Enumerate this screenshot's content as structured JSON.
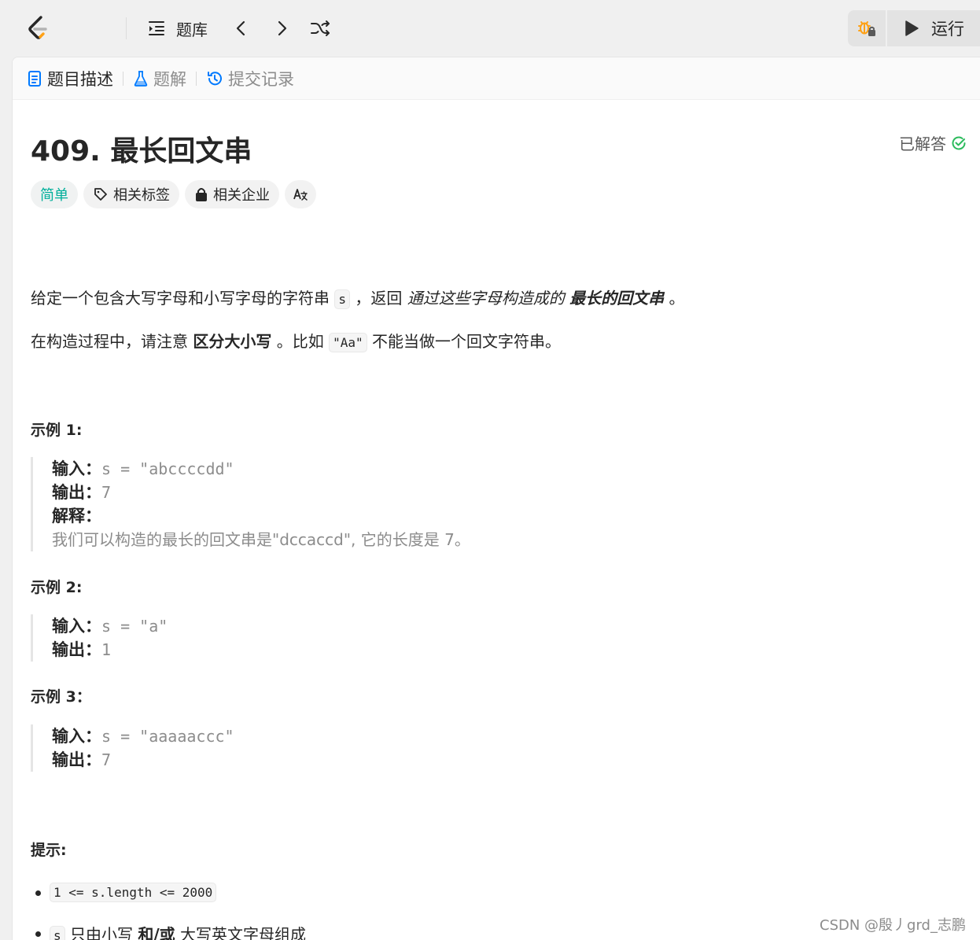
{
  "topbar": {
    "problem_list_label": "题库",
    "run_label": "运行"
  },
  "tabs": [
    {
      "label": "题目描述",
      "active": true
    },
    {
      "label": "题解",
      "active": false
    },
    {
      "label": "提交记录",
      "active": false
    }
  ],
  "problem": {
    "title": "409. 最长回文串",
    "solved_label": "已解答",
    "tags": {
      "difficulty": "简单",
      "related_tags": "相关标签",
      "related_companies": "相关企业",
      "translate": "A文"
    },
    "desc1": {
      "a": "给定一个包含大写字母和小写字母的字符串",
      "code": "s",
      "b": "，返回",
      "italic": "通过这些字母构造成的",
      "bolditalic": "最长的回文串",
      "c": "。"
    },
    "desc2": {
      "a": "在构造过程中，请注意",
      "bold": "区分大小写",
      "b": "。比如",
      "code": "\"Aa\"",
      "c": "不能当做一个回文字符串。"
    },
    "examples": [
      {
        "title": "示例 1:",
        "input_label": "输入：",
        "input": "s = \"abccccdd\"",
        "output_label": "输出：",
        "output": "7",
        "explain_label": "解释：",
        "explain": "我们可以构造的最长的回文串是\"dccaccd\", 它的长度是 7。"
      },
      {
        "title": "示例 2:",
        "input_label": "输入：",
        "input": "s = \"a\"",
        "output_label": "输出：",
        "output": "1"
      },
      {
        "title": "示例 3：",
        "input_label": "输入：",
        "input": "s = \"aaaaaccc\"",
        "output_label": "输出：",
        "output": "7"
      }
    ],
    "hints_title": "提示:",
    "hints": {
      "h1_code": "1 <= s.length <= 2000",
      "h2_code": "s",
      "h2_a": "只由小写",
      "h2_bold": "和/或",
      "h2_b": "大写英文字母组成"
    }
  },
  "watermark": "CSDN @殷丿grd_志鹏",
  "colors": {
    "easy": "#00af9b",
    "solved": "#2cbb5d",
    "accent_blue": "#007aff",
    "debug_orange": "#ffa116"
  }
}
